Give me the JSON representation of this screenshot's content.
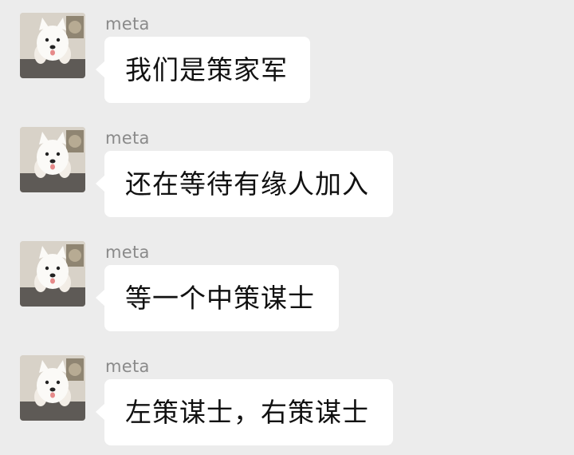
{
  "chat": {
    "messages": [
      {
        "sender": "meta",
        "text": "我们是策家军",
        "avatar": "samoyed-dog-avatar"
      },
      {
        "sender": "meta",
        "text": "还在等待有缘人加入",
        "avatar": "samoyed-dog-avatar"
      },
      {
        "sender": "meta",
        "text": "等一个中策谋士",
        "avatar": "samoyed-dog-avatar"
      },
      {
        "sender": "meta",
        "text": "左策谋士，右策谋士",
        "avatar": "samoyed-dog-avatar"
      }
    ]
  },
  "colors": {
    "background": "#ececec",
    "bubble": "#ffffff",
    "sender_name": "#8a8a8a",
    "message_text": "#111111"
  }
}
